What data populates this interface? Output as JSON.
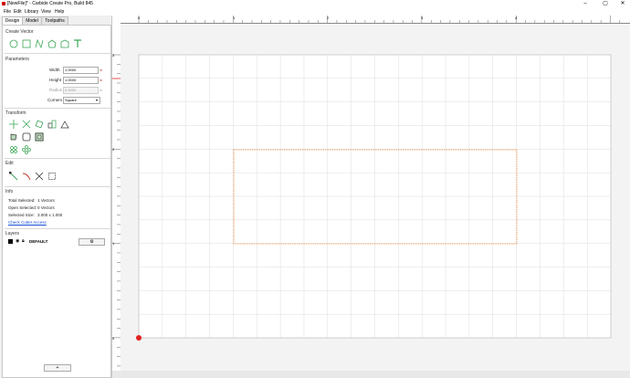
{
  "window": {
    "title": "[NewFile]* - Carbide Create Pro, Build 845",
    "minimize": "–",
    "maximize": "▢",
    "close": "✕"
  },
  "menu": [
    "File",
    "Edit",
    "Library",
    "View",
    "Help"
  ],
  "tabs": [
    "Design",
    "Model",
    "Toolpaths"
  ],
  "sections": {
    "create_vector": "Create Vector",
    "parameters": "Parameters",
    "transform": "Transform",
    "edit": "Edit",
    "info": "Info",
    "layers": "Layers"
  },
  "parameters": {
    "width_label": "Width",
    "width_value": "1.0000",
    "width_unit": "in",
    "height_label": "Height",
    "height_value": "1.0000",
    "height_unit": "in",
    "radius_label": "Radius",
    "radius_value": "0.0000",
    "radius_unit": "in",
    "corners_label": "Corners",
    "corners_value": "Square"
  },
  "info": {
    "total_selected_label": "Total Selected:",
    "total_selected_value": "1 Vectors",
    "open_selected_label": "Open Selected:",
    "open_selected_value": "0 Vectors",
    "selected_size_label": "Selected Size:",
    "selected_size_value": "3.000 x 1.000",
    "check_cutter_access": "Check Cutter Access"
  },
  "layers": {
    "items": [
      {
        "name": "DEFAULT"
      }
    ]
  },
  "bottom_button": "+",
  "ruler_top_labels": [
    "0",
    "1",
    "2",
    "3",
    "4"
  ],
  "ruler_left_labels": [
    "3",
    "2",
    "1",
    "0"
  ],
  "colors": {
    "vector_green": "#3aa655",
    "selection_orange": "#f08a3c",
    "origin_red": "#e02020",
    "grid_line": "#dcdcdc"
  }
}
